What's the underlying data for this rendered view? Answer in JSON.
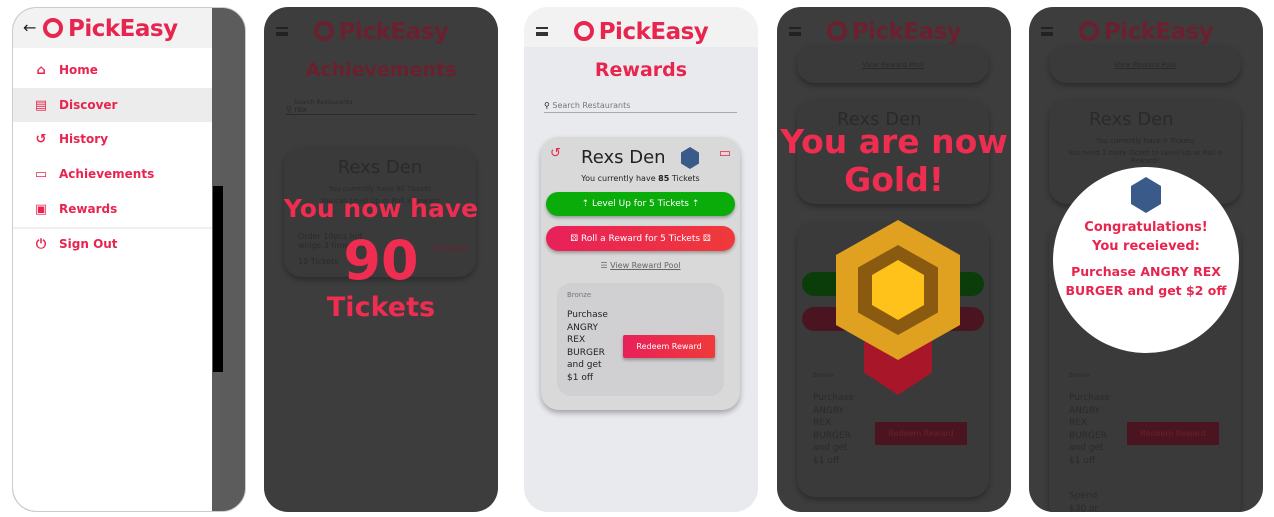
{
  "app": {
    "name": "PickEasy"
  },
  "screen1": {
    "menu": [
      {
        "label": "Home",
        "icon": "home-icon"
      },
      {
        "label": "Discover",
        "icon": "store-icon"
      },
      {
        "label": "History",
        "icon": "history-icon"
      },
      {
        "label": "Achievements",
        "icon": "achievement-icon"
      },
      {
        "label": "Rewards",
        "icon": "gift-icon"
      },
      {
        "label": "Sign Out",
        "icon": "power-icon"
      }
    ]
  },
  "screen2": {
    "title": "Achievements",
    "search_label": "Search Restaurants",
    "search_value": "rex",
    "restaurant": "Rexs Den",
    "tickets_line": "You currently have 90 Tickets",
    "can_line": "You can Level Up or Roll a Reward",
    "task": "Order 10pcs hot wings 3 time(s) for",
    "task_cost": "10 Tickets",
    "activate": "Activate",
    "overlay_line1": "You now have",
    "overlay_number": "90",
    "overlay_line2": "Tickets"
  },
  "screen3": {
    "title": "Rewards",
    "search_placeholder": "Search Restaurants",
    "restaurant": "Rexs Den",
    "tickets_prefix": "You currently have",
    "tickets_count": "85",
    "tickets_suffix": "Tickets",
    "level_up": "Level Up for 5 Tickets",
    "roll": "Roll a Reward for 5 Tickets",
    "view_pool": "View Reward Pool",
    "tier": "Bronze",
    "reward": "Purchase ANGRY REX BURGER and get $1 off",
    "redeem": "Redeem Reward"
  },
  "screen4": {
    "view_pool": "View Reward Pool",
    "restaurant": "Rexs Den",
    "overlay": "You are now Gold!",
    "reward": "Purchase ANGRY REX BURGER and get $1 off",
    "tier": "Bronze",
    "redeem": "Redeem Reward"
  },
  "screen5": {
    "view_pool": "View Reward Pool",
    "restaurant": "Rexs Den",
    "tickets_line": "You currently have 0 Tickets",
    "need_line": "You need 1 more Ticket to Level Up or Roll a Reward!",
    "congrats": "Congratulations!",
    "received": "You receieved:",
    "prize": "Purchase ANGRY REX BURGER and get $2 off",
    "tier": "Bronze",
    "reward": "Purchase ANGRY REX BURGER and get $1 off",
    "redeem": "Redeem Reward",
    "spend": "Spend $30 or"
  },
  "colors": {
    "brand": "#e8254f",
    "green": "#0aac0a",
    "dark_overlay": "#3d3d3d"
  }
}
